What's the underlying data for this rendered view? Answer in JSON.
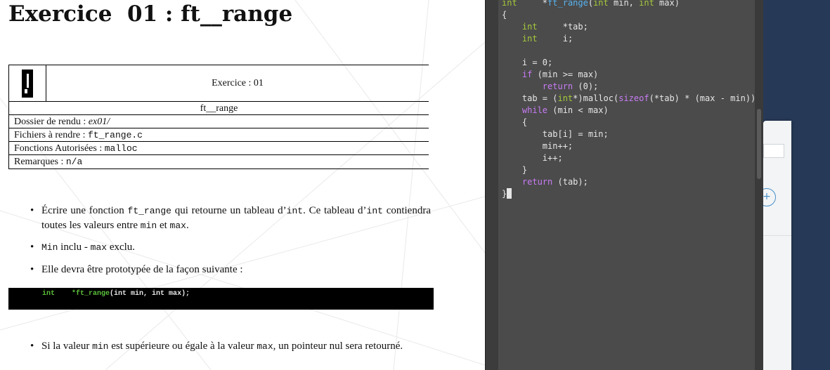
{
  "pdf": {
    "title": "Exercice  01 : ft__range",
    "info": {
      "exercise_label": "Exercice :  01",
      "exercise_name": "ft__range",
      "rows": [
        {
          "label": "Dossier de rendu : ",
          "value": "ex01/"
        },
        {
          "label": "Fichiers à rendre : ",
          "value": "ft_range.c"
        },
        {
          "label": "Fonctions Autorisées : ",
          "value": "malloc"
        },
        {
          "label": "Remarques : ",
          "value": "n/a"
        }
      ]
    },
    "bullets": [
      {
        "parts": [
          "Écrire une fonction ",
          "ft_range",
          " qui retourne un tableau d’",
          "int",
          ". Ce tableau d’",
          "int",
          " contiendra toutes les valeurs entre ",
          "min",
          " et ",
          "max",
          "."
        ]
      },
      {
        "parts": [
          "Min",
          " inclu - ",
          "max",
          " exclu."
        ]
      },
      {
        "parts": [
          "Elle devra être prototypée de la façon suivante :"
        ]
      },
      {
        "parts": [
          "Si la valeur ",
          "min",
          " est supérieure ou égale à la valeur ",
          "max",
          ", un pointeur nul sera retourné."
        ]
      }
    ],
    "prototype": {
      "type": "int",
      "gap": "    ",
      "pointer": "*ft_range",
      "args": "(int min, int max);"
    }
  },
  "editor": {
    "lines": [
      [
        [
          "ty",
          "int"
        ],
        [
          "nm",
          "     *"
        ],
        [
          "fn",
          "ft_range"
        ],
        [
          "nm",
          "("
        ],
        [
          "ty",
          "int"
        ],
        [
          "nm",
          " min, "
        ],
        [
          "ty",
          "int"
        ],
        [
          "nm",
          " max)"
        ]
      ],
      [
        [
          "nm",
          "{"
        ]
      ],
      [
        [
          "nm",
          "    "
        ],
        [
          "ty",
          "int"
        ],
        [
          "nm",
          "     *tab;"
        ]
      ],
      [
        [
          "nm",
          "    "
        ],
        [
          "ty",
          "int"
        ],
        [
          "nm",
          "     i;"
        ]
      ],
      [
        [
          "nm",
          ""
        ]
      ],
      [
        [
          "nm",
          "    i = 0;"
        ]
      ],
      [
        [
          "nm",
          "    "
        ],
        [
          "kw",
          "if"
        ],
        [
          "nm",
          " (min >= max)"
        ]
      ],
      [
        [
          "nm",
          "        "
        ],
        [
          "kw",
          "return"
        ],
        [
          "nm",
          " (0);"
        ]
      ],
      [
        [
          "nm",
          "    tab = ("
        ],
        [
          "ty",
          "int"
        ],
        [
          "nm",
          "*)malloc("
        ],
        [
          "kw",
          "sizeof"
        ],
        [
          "nm",
          "(*tab) * (max - min));"
        ]
      ],
      [
        [
          "nm",
          "    "
        ],
        [
          "kw",
          "while"
        ],
        [
          "nm",
          " (min < max)"
        ]
      ],
      [
        [
          "nm",
          "    {"
        ]
      ],
      [
        [
          "nm",
          "        tab[i] = min;"
        ]
      ],
      [
        [
          "nm",
          "        min++;"
        ]
      ],
      [
        [
          "nm",
          "        i++;"
        ]
      ],
      [
        [
          "nm",
          "    }"
        ]
      ],
      [
        [
          "nm",
          "    "
        ],
        [
          "kw",
          "return"
        ],
        [
          "nm",
          " (tab);"
        ]
      ],
      [
        [
          "nm",
          "}"
        ],
        [
          "cursor",
          ""
        ]
      ]
    ]
  },
  "background_app": {
    "plus_label": "+"
  },
  "colors": {
    "keyword": "#c87cf5",
    "type": "#a5c93a",
    "function": "#58b3f0",
    "editor_bg": "#4b4b4b",
    "desktop_bg": "#263a57"
  }
}
